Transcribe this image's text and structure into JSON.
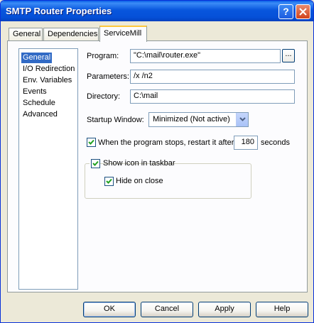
{
  "window": {
    "title": "SMTP Router Properties"
  },
  "tabs": [
    {
      "label": "General"
    },
    {
      "label": "Dependencies"
    },
    {
      "label": "ServiceMill"
    }
  ],
  "side_list": {
    "items": [
      "General",
      "I/O Redirection",
      "Env. Variables",
      "Events",
      "Schedule",
      "Advanced"
    ],
    "selected": "General"
  },
  "program": {
    "label": "Program:",
    "value": "\"C:\\mail\\router.exe\"",
    "browse_label": "..."
  },
  "parameters": {
    "label": "Parameters:",
    "value": "/x /n2"
  },
  "directory": {
    "label": "Directory:",
    "value": "C:\\mail"
  },
  "startup_window": {
    "label": "Startup Window:",
    "value": "Minimized (Not active)"
  },
  "restart": {
    "label": "When the program stops, restart it after",
    "checked": true,
    "value": "180",
    "unit": "seconds"
  },
  "show_icon": {
    "label": "Show icon in taskbar",
    "checked": true
  },
  "hide_on_close": {
    "label": "Hide on close",
    "checked": true
  },
  "buttons": {
    "ok": "OK",
    "cancel": "Cancel",
    "apply": "Apply",
    "help": "Help"
  },
  "colors": {
    "title_bar": "#0A5FE6",
    "selection": "#316AC5",
    "tab_highlight": "#FFC83C"
  }
}
